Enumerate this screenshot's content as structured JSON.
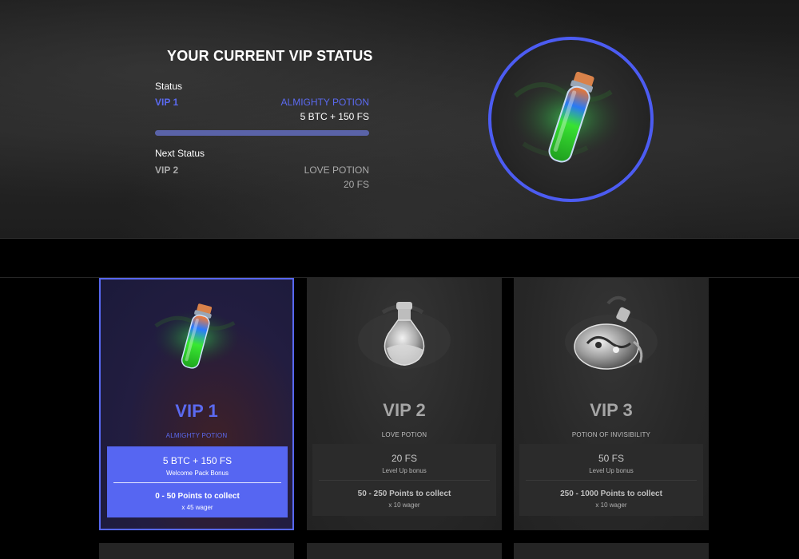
{
  "header": {
    "title": "YOUR CURRENT VIP STATUS",
    "status_label": "Status",
    "current": {
      "tier": "VIP 1",
      "name": "ALMIGHTY POTION",
      "prize": "5 BTC + 150 FS"
    },
    "progress": 1.0,
    "next_label": "Next Status",
    "next": {
      "tier": "VIP 2",
      "name": "LOVE POTION",
      "prize": "20 FS"
    },
    "badge_icon": "green-potion-vial-icon"
  },
  "cards": [
    {
      "tier": "VIP 1",
      "name": "ALMIGHTY POTION",
      "icon": "green-potion-vial-icon",
      "prize": "5 BTC + 150 FS",
      "prize_sub": "Welcome Pack Bonus",
      "points": "0 - 50 Points to collect",
      "wager": "x 45 wager",
      "active": true
    },
    {
      "tier": "VIP 2",
      "name": "LOVE POTION",
      "icon": "round-flask-icon",
      "prize": "20 FS",
      "prize_sub": "Level Up bonus",
      "points": "50 - 250 Points to collect",
      "wager": "x 10 wager",
      "active": false
    },
    {
      "tier": "VIP 3",
      "name": "POTION OF INVISIBILITY",
      "icon": "yin-yang-flask-icon",
      "prize": "50 FS",
      "prize_sub": "Level Up bonus",
      "points": "250 - 1000 Points to collect",
      "wager": "x 10 wager",
      "active": false
    }
  ],
  "colors": {
    "accent": "#5666f2",
    "accent_text": "#5b6af0",
    "muted": "#a6a6a6"
  }
}
